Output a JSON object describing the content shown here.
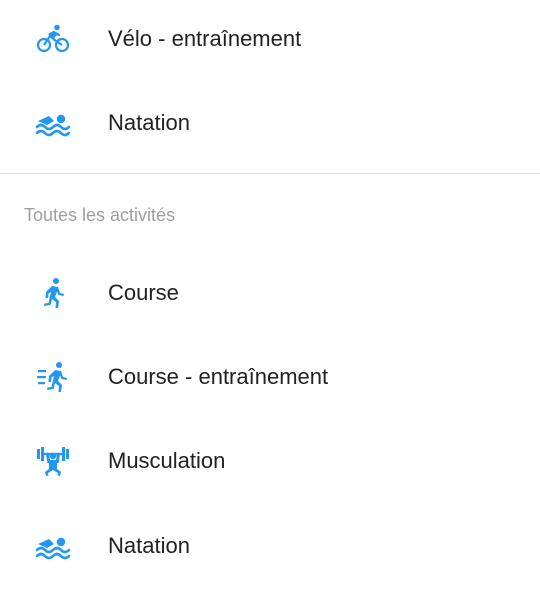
{
  "accent_color": "#2196f3",
  "recent": [
    {
      "label": "Vélo - entraînement",
      "icon": "bike-icon"
    },
    {
      "label": "Natation",
      "icon": "swim-icon"
    }
  ],
  "all_activities": {
    "header": "Toutes les activités",
    "items": [
      {
        "label": "Course",
        "icon": "run-icon"
      },
      {
        "label": "Course - entraînement",
        "icon": "run-fast-icon"
      },
      {
        "label": "Musculation",
        "icon": "weightlifting-icon"
      },
      {
        "label": "Natation",
        "icon": "swim-icon"
      }
    ]
  }
}
